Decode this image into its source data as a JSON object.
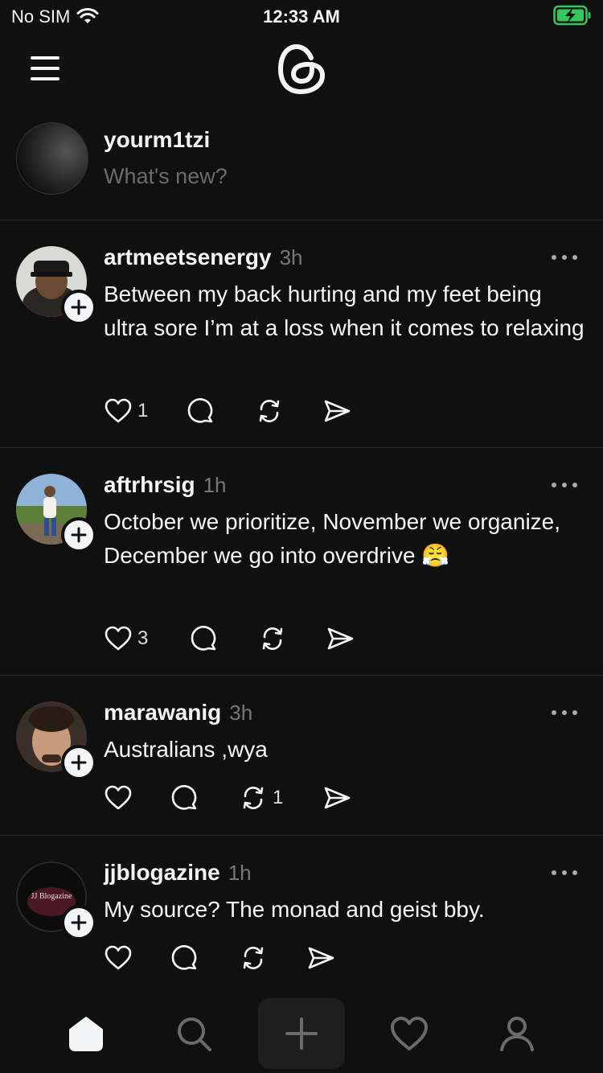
{
  "status": {
    "carrier": "No SIM",
    "time": "12:33 AM"
  },
  "composer": {
    "username": "yourm1tzi",
    "placeholder": "What's new?"
  },
  "posts": [
    {
      "username": "artmeetsenergy",
      "time": "3h",
      "text": "Between my back hurting and my feet being ultra sore I’m at a loss when it comes to relaxing",
      "likes": "1",
      "comments": "",
      "reposts": ""
    },
    {
      "username": "aftrhrsig",
      "time": "1h",
      "text": "October we prioritize, November we organize, December we go into overdrive 😤",
      "likes": "3",
      "comments": "",
      "reposts": ""
    },
    {
      "username": "marawanig",
      "time": "3h",
      "text": "Australians ,wya",
      "likes": "",
      "comments": "",
      "reposts": "1"
    },
    {
      "username": "jjblogazine",
      "time": "1h",
      "text": "My source? The monad and geist bby.",
      "likes": "",
      "comments": "",
      "reposts": "",
      "avatar_text": "JJ Blogazine"
    }
  ],
  "tabs": [
    "home-icon",
    "search-icon",
    "compose-icon",
    "activity-heart-icon",
    "profile-icon"
  ],
  "colors": {
    "background": "#101010",
    "text": "#f3f5f7",
    "muted": "#777777",
    "battery": "#34c759"
  }
}
